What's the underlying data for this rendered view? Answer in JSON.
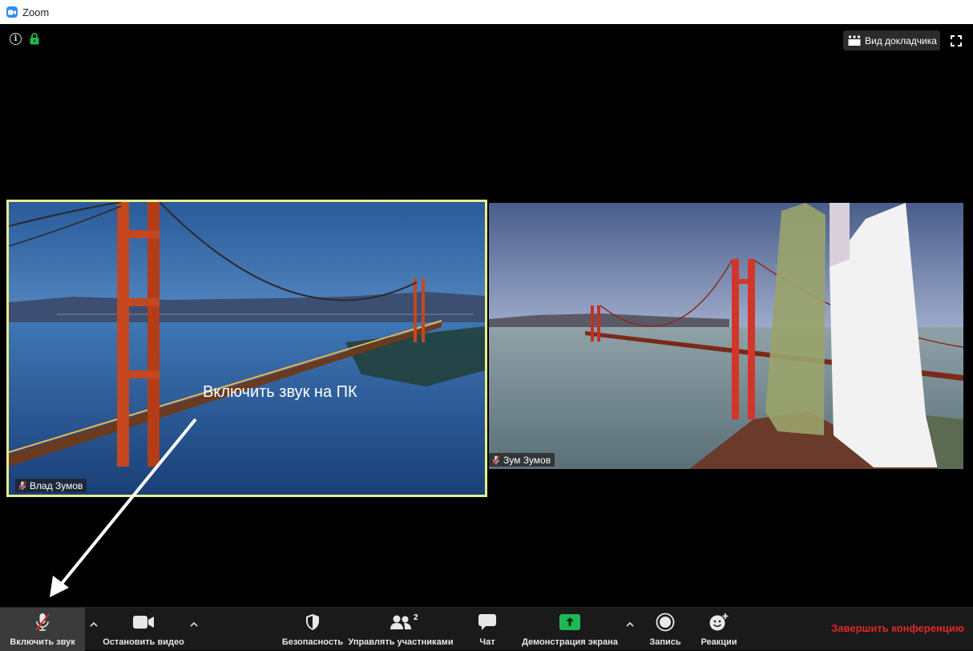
{
  "window": {
    "title": "Zoom"
  },
  "top_bar": {
    "view_label": "Вид докладчика"
  },
  "participants": [
    {
      "name": "Влад Зумов",
      "muted": true,
      "active_speaker": true
    },
    {
      "name": "Зум Зумов",
      "muted": true,
      "active_speaker": false
    }
  ],
  "annotation": {
    "text": "Включить звук на ПК"
  },
  "toolbar": {
    "audio_label": "Включить звук",
    "video_label": "Остановить видео",
    "security_label": "Безопасность",
    "participants_label": "Управлять участниками",
    "participants_count": "2",
    "chat_label": "Чат",
    "share_label": "Демонстрация экрана",
    "record_label": "Запись",
    "reactions_label": "Реакции",
    "end_label": "Завершить конференцию"
  },
  "colors": {
    "accent": "#2D8CFF",
    "active_speaker_border": "#e6ee8e",
    "share_green": "#1DB954",
    "end_red": "#e02828",
    "lock_green": "#21b94a"
  }
}
